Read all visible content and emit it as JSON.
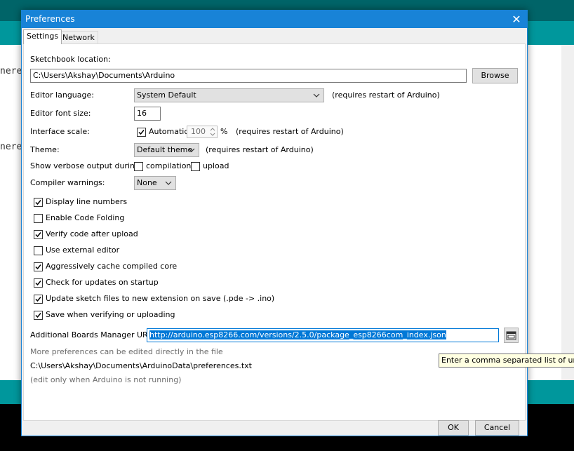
{
  "background": {
    "code_line_1": "nere",
    "code_line_2": "nere,"
  },
  "dialog": {
    "title": "Preferences",
    "close_symbol": "✕",
    "tabs": [
      {
        "label": "Settings",
        "active": true
      },
      {
        "label": "Network",
        "active": false
      }
    ]
  },
  "settings": {
    "sketchbook_label": "Sketchbook location:",
    "sketchbook_path": "C:\\Users\\Akshay\\Documents\\Arduino",
    "browse_label": "Browse",
    "editor_language_label": "Editor language:",
    "editor_language_value": "System Default",
    "editor_language_note": "(requires restart of Arduino)",
    "font_size_label": "Editor font size:",
    "font_size_value": "16",
    "interface_scale_label": "Interface scale:",
    "automatic_label": "Automatic",
    "automatic_checked": true,
    "scale_value": "100",
    "percent_sign": "%",
    "interface_scale_note": "(requires restart of Arduino)",
    "theme_label": "Theme:",
    "theme_value": "Default theme",
    "theme_note": "(requires restart of Arduino)",
    "verbose_label": "Show verbose output during:",
    "verbose_compilation_label": "compilation",
    "verbose_compilation_checked": false,
    "verbose_upload_label": "upload",
    "verbose_upload_checked": false,
    "compiler_warnings_label": "Compiler warnings:",
    "compiler_warnings_value": "None",
    "options": [
      {
        "label": "Display line numbers",
        "checked": true
      },
      {
        "label": "Enable Code Folding",
        "checked": false
      },
      {
        "label": "Verify code after upload",
        "checked": true
      },
      {
        "label": "Use external editor",
        "checked": false
      },
      {
        "label": "Aggressively cache compiled core",
        "checked": true
      },
      {
        "label": "Check for updates on startup",
        "checked": true
      },
      {
        "label": "Update sketch files to new extension on save (.pde -> .ino)",
        "checked": true
      },
      {
        "label": "Save when verifying or uploading",
        "checked": true
      }
    ],
    "boards_urls_label": "Additional Boards Manager URLs:",
    "boards_urls_value": "http://arduino.esp8266.com/versions/2.5.0/package_esp8266com_index.json",
    "more_prefs_note": "More preferences can be edited directly in the file",
    "prefs_path": "C:\\Users\\Akshay\\Documents\\ArduinoData\\preferences.txt",
    "edit_note": "(edit only when Arduino is not running)"
  },
  "tooltip": "Enter a comma separated list of urls",
  "footer": {
    "ok_label": "OK",
    "cancel_label": "Cancel"
  },
  "colors": {
    "accent": "#1883d7",
    "arduino_teal": "#00979c",
    "arduino_dark_teal": "#006468",
    "selection": "#0078d7"
  }
}
